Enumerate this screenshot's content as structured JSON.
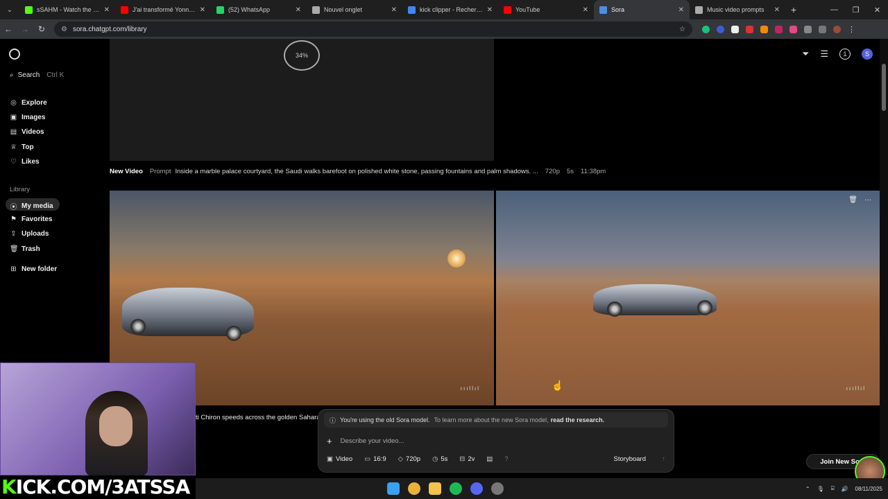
{
  "browser": {
    "tabs": [
      {
        "title": "sSAHM - Watch the VOD",
        "color": "#53fc18"
      },
      {
        "title": "J'ai transformé Yonna en",
        "color": "#ff0000"
      },
      {
        "title": "(52) WhatsApp",
        "color": "#25d366"
      },
      {
        "title": "Nouvel onglet",
        "color": "#aaaaaa"
      },
      {
        "title": "kick clipper - Recherche G",
        "color": "#4285f4"
      },
      {
        "title": "YouTube",
        "color": "#ff0000"
      },
      {
        "title": "Sora",
        "color": "#4a90e2",
        "active": true
      },
      {
        "title": "Music video prompts",
        "color": "#aaaaaa"
      }
    ],
    "url": "sora.chatgpt.com/library"
  },
  "sidebar": {
    "search_label": "Search",
    "search_shortcut": "Ctrl K",
    "nav": [
      "Explore",
      "Images",
      "Videos",
      "Top",
      "Likes"
    ],
    "library_heading": "Library",
    "library": [
      "My media",
      "Favorites",
      "Uploads",
      "Trash"
    ],
    "new_folder": "New folder"
  },
  "topbar": {
    "notifications_count": "1",
    "avatar_initial": "S"
  },
  "pending": {
    "progress_percent": "34%"
  },
  "video_meta": {
    "type": "New Video",
    "prompt_label": "Prompt",
    "prompt": "Inside a marble palace courtyard, the Saudi walks barefoot on polished white stone, passing fountains and palm shadows. ...",
    "resolution": "720p",
    "duration": "5s",
    "time": "11:38pm"
  },
  "caption_partial": "ti Chiron speeds across the golden Sahara",
  "composer": {
    "notice_main": "You're using the old Sora model.",
    "notice_muted": "To learn more about the new Sora model,",
    "notice_link": "read the research.",
    "placeholder": "Describe your video...",
    "options": {
      "type": "Video",
      "ratio": "16:9",
      "resolution": "720p",
      "duration": "5s",
      "variations": "2v",
      "help": "?"
    },
    "storyboard": "Storyboard"
  },
  "join_button": "Join New Sora",
  "stream": {
    "overlay_text_prefix": "K",
    "overlay_text_rest": "ICK.COM/3ATSSA"
  },
  "taskbar": {
    "date": "08/11/2025"
  }
}
